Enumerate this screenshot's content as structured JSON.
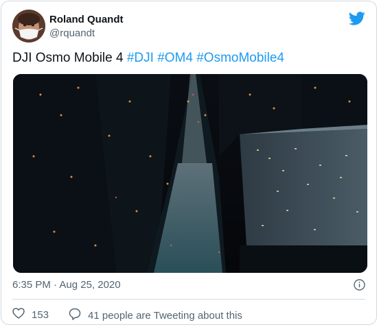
{
  "author": {
    "name": "Roland Quandt",
    "handle": "@rquandt"
  },
  "tweet": {
    "text_prefix": "DJI Osmo Mobile 4",
    "hashtags": [
      "#DJI",
      "#OM4",
      "#OsmoMobile4"
    ]
  },
  "meta": {
    "timestamp": "6:35 PM · Aug 25, 2020"
  },
  "actions": {
    "likes_count": "153",
    "tweeting_label": "41 people are Tweeting about this"
  },
  "icons": {
    "brand": "twitter-bird-icon",
    "info": "info-icon",
    "like": "heart-icon",
    "reply": "speech-bubble-icon"
  },
  "colors": {
    "accent": "#1d9bf0",
    "secondary_text": "#536471",
    "border": "#cfd9de"
  }
}
